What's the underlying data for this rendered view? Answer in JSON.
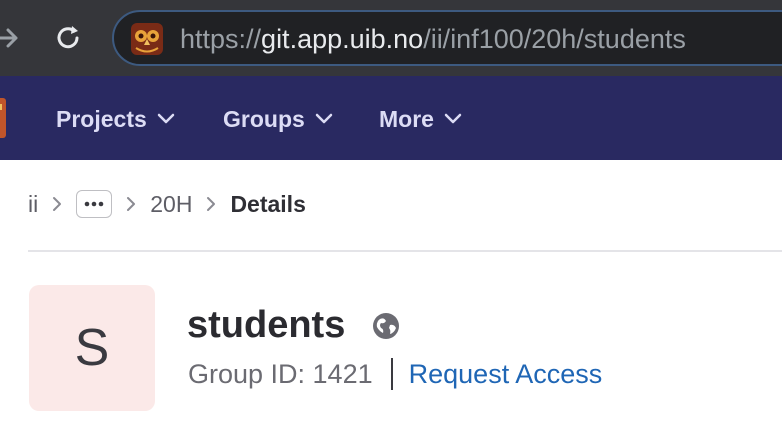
{
  "browser": {
    "url_scheme": "https://",
    "url_host": "git.app.uib.no",
    "url_path": "/ii/inf100/20h/students"
  },
  "topnav": {
    "items": [
      {
        "label": "Projects"
      },
      {
        "label": "Groups"
      },
      {
        "label": "More"
      }
    ]
  },
  "breadcrumb": {
    "root": "ii",
    "middle": "20H",
    "current": "Details"
  },
  "group": {
    "avatar_letter": "S",
    "name": "students",
    "visibility_icon": "globe-icon",
    "id_label": "Group ID: 1421",
    "request_access_label": "Request Access"
  },
  "colors": {
    "nav_bg": "#292961",
    "link": "#1f66b5",
    "avatar_bg": "#fbe9e8"
  }
}
